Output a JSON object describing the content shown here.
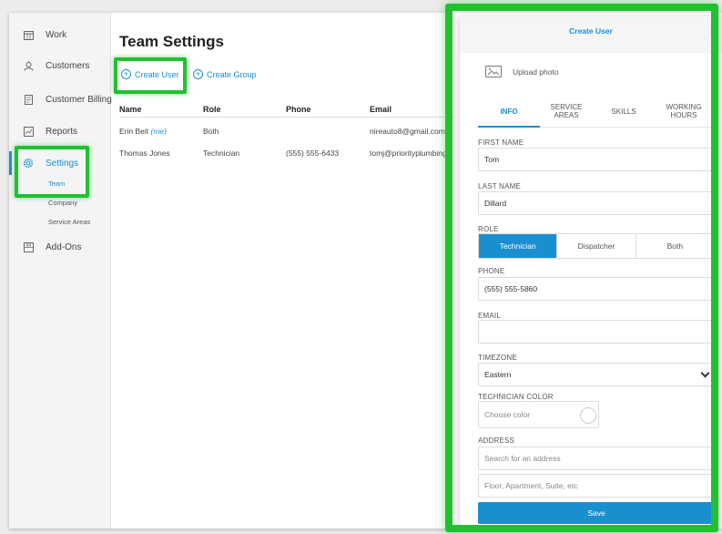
{
  "sidebar": {
    "items": [
      {
        "label": "Work",
        "icon": "calendar-icon"
      },
      {
        "label": "Customers",
        "icon": "customers-icon"
      },
      {
        "label": "Customer Billing",
        "icon": "billing-icon"
      },
      {
        "label": "Reports",
        "icon": "reports-icon"
      },
      {
        "label": "Settings",
        "icon": "gear-icon"
      },
      {
        "label": "Add-Ons",
        "icon": "addons-icon"
      }
    ],
    "settings_sub": [
      "Team",
      "Company",
      "Service Areas"
    ]
  },
  "main": {
    "title": "Team Settings",
    "create_user_label": "Create User",
    "create_group_label": "Create Group",
    "columns": [
      "Name",
      "Role",
      "Phone",
      "Email"
    ],
    "rows": [
      {
        "name": "Erin Beit",
        "me_tag": "(me)",
        "role": "Both",
        "phone": "",
        "email": "nireauto8@gmail.com"
      },
      {
        "name": "Thomas Jones",
        "me_tag": "",
        "role": "Technician",
        "phone": "(555) 555-6433",
        "email": "tomj@priorityplumbing"
      }
    ]
  },
  "modal": {
    "title": "Create User",
    "close_glyph": "×",
    "upload_label": "Upload photo",
    "tabs": [
      {
        "line1": "INFO",
        "line2": ""
      },
      {
        "line1": "SERVICE",
        "line2": "AREAS"
      },
      {
        "line1": "SKILLS",
        "line2": ""
      },
      {
        "line1": "WORKING",
        "line2": "HOURS"
      }
    ],
    "first_name": {
      "label": "FIRST NAME",
      "value": "Tom"
    },
    "last_name": {
      "label": "LAST NAME",
      "value": "Dillard"
    },
    "role": {
      "label": "ROLE",
      "options": [
        "Technician",
        "Dispatcher",
        "Both"
      ],
      "selected": "Technician"
    },
    "phone": {
      "label": "PHONE",
      "value": "(555) 555-5860"
    },
    "email": {
      "label": "EMAIL",
      "value": ""
    },
    "timezone": {
      "label": "TIMEZONE",
      "value": "Eastern"
    },
    "tech_color": {
      "label": "TECHNICIAN COLOR",
      "placeholder": "Choose color"
    },
    "address": {
      "label": "ADDRESS",
      "search_placeholder": "Search for an address",
      "unit_placeholder": "Floor, Apartment, Suite, etc"
    },
    "save_label": "Save"
  },
  "colors": {
    "accent": "#1a8fd0",
    "highlight": "#1fc12f"
  }
}
